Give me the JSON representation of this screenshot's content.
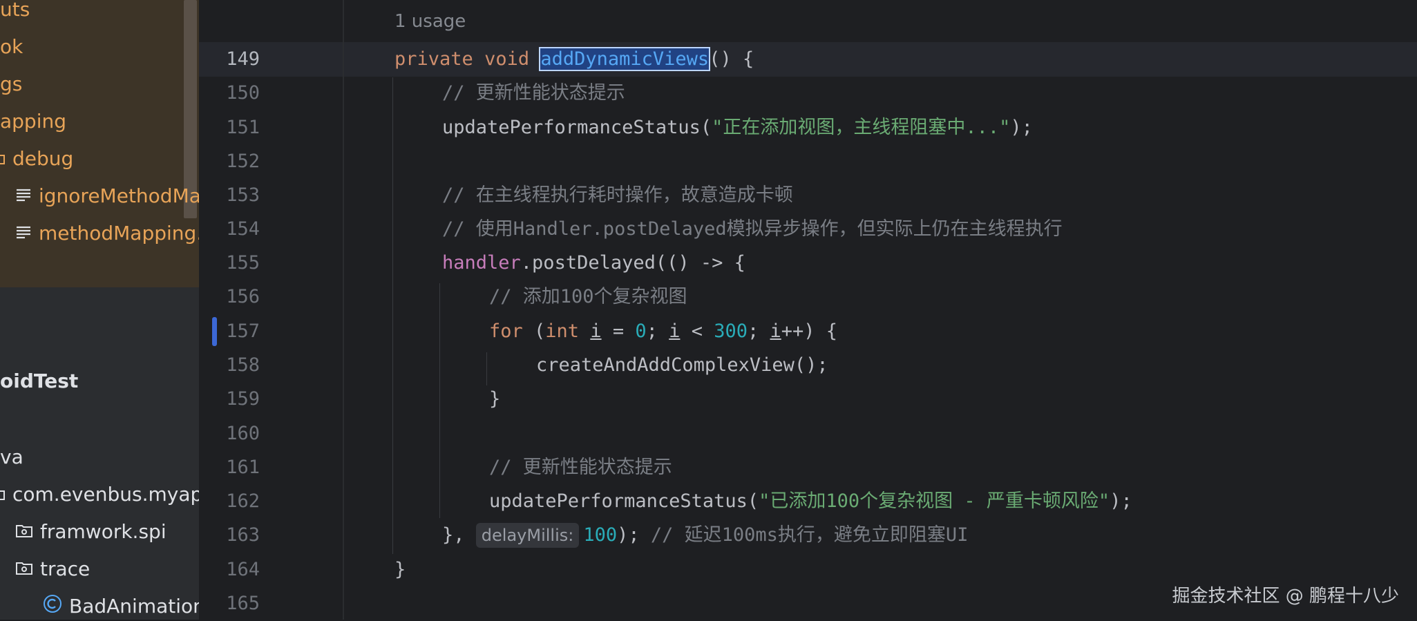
{
  "sidebar": {
    "items": [
      {
        "label": "uts"
      },
      {
        "label": "ok"
      },
      {
        "label": "gs"
      },
      {
        "label": "apping"
      },
      {
        "label": "debug"
      },
      {
        "label": "ignoreMethodMa"
      },
      {
        "label": "methodMapping.t"
      },
      {
        "label": "oidTest"
      },
      {
        "label": "va"
      },
      {
        "label": "com.evenbus.myappl"
      },
      {
        "label": "framwork.spi"
      },
      {
        "label": "trace"
      },
      {
        "label": "BadAnimation"
      }
    ]
  },
  "editor": {
    "usage_hint": "1 usage",
    "lines": [
      {
        "num": "149"
      },
      {
        "num": "150"
      },
      {
        "num": "151"
      },
      {
        "num": "152"
      },
      {
        "num": "153"
      },
      {
        "num": "154"
      },
      {
        "num": "155"
      },
      {
        "num": "156"
      },
      {
        "num": "157"
      },
      {
        "num": "158"
      },
      {
        "num": "159"
      },
      {
        "num": "160"
      },
      {
        "num": "161"
      },
      {
        "num": "162"
      },
      {
        "num": "163"
      },
      {
        "num": "164"
      },
      {
        "num": "165"
      }
    ],
    "code": {
      "l149_kw1": "private",
      "l149_kw2": "void",
      "l149_fn": "addDynamicViews",
      "l149_rest": "() {",
      "l150": "// 更新性能状态提示",
      "l151_fn": "updatePerformanceStatus(",
      "l151_str": "\"正在添加视图，主线程阻塞中...\"",
      "l151_end": ");",
      "l153": "// 在主线程执行耗时操作，故意造成卡顿",
      "l154": "// 使用Handler.postDelayed模拟异步操作，但实际上仍在主线程执行",
      "l155_field": "handler",
      "l155_rest": ".postDelayed(() -> {",
      "l156": "// 添加100个复杂视图",
      "l157_for": "for",
      "l157_p1": " (",
      "l157_int": "int",
      "l157_sp": " ",
      "l157_i1": "i",
      "l157_eq": " = ",
      "l157_zero": "0",
      "l157_semi1": "; ",
      "l157_i2": "i",
      "l157_lt": " < ",
      "l157_300": "300",
      "l157_semi2": "; ",
      "l157_i3": "i",
      "l157_end": "++) {",
      "l158": "createAndAddComplexView();",
      "l159": "}",
      "l161": "// 更新性能状态提示",
      "l162_fn": "updatePerformanceStatus(",
      "l162_str": "\"已添加100个复杂视图 - 严重卡顿风险\"",
      "l162_end": ");",
      "l163_a": "}, ",
      "l163_hint": "delayMillis:",
      "l163_num": "100",
      "l163_b": "); ",
      "l163_cmt": "// 延迟100ms执行，避免立即阻塞UI",
      "l164": "}"
    }
  },
  "watermark": "掘金技术社区 @ 鹏程十八少"
}
